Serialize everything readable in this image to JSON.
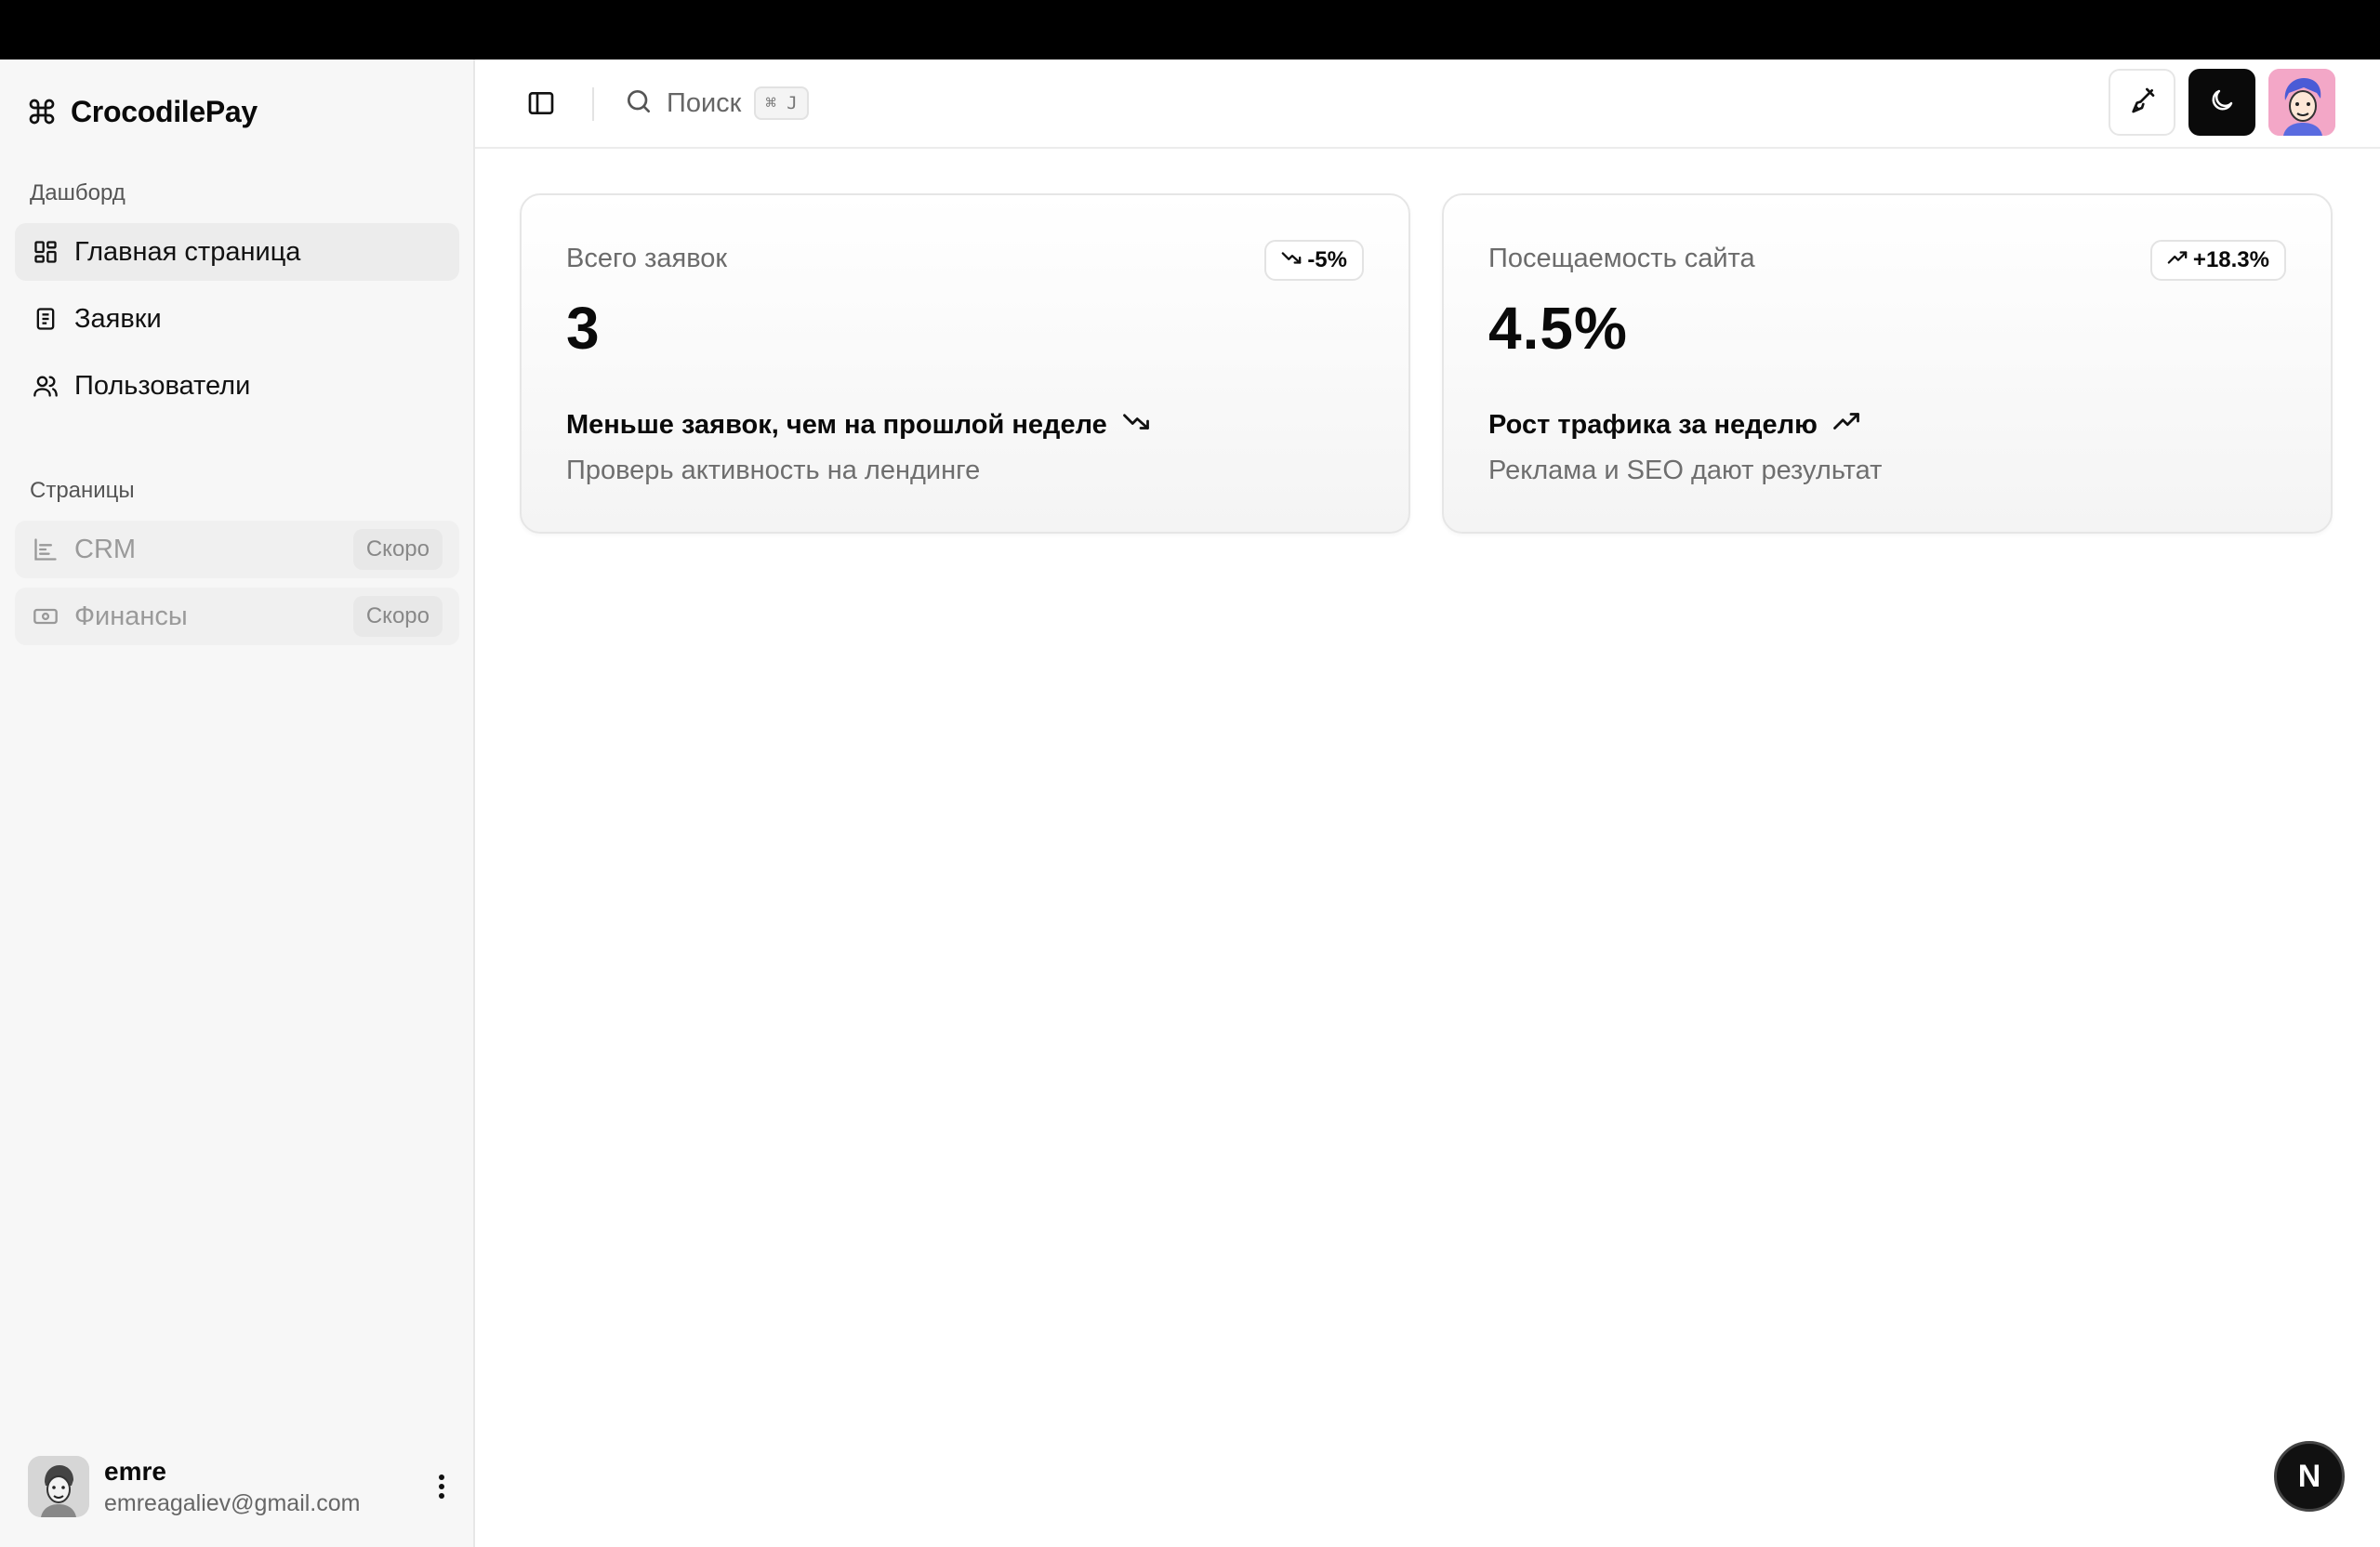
{
  "brand": {
    "name": "CrocodilePay"
  },
  "sidebar": {
    "group1_label": "Дашборд",
    "items": [
      {
        "label": "Главная страница",
        "icon": "dashboard-icon",
        "active": true
      },
      {
        "label": "Заявки",
        "icon": "document-icon"
      },
      {
        "label": "Пользователи",
        "icon": "users-icon"
      }
    ],
    "group2_label": "Страницы",
    "pages": [
      {
        "label": "CRM",
        "icon": "chart-icon",
        "badge": "Скоро"
      },
      {
        "label": "Финансы",
        "icon": "banknote-icon",
        "badge": "Скоро"
      }
    ],
    "user": {
      "name": "emre",
      "email": "emreagaliev@gmail.com"
    }
  },
  "header": {
    "search_label": "Поиск",
    "shortcut": "⌘ J"
  },
  "cards": [
    {
      "label": "Всего заявок",
      "value": "3",
      "badge": "-5%",
      "trend": "down",
      "footer": "Меньше заявок, чем на прошлой неделе",
      "sub": "Проверь активность на лендинге"
    },
    {
      "label": "Посещаемость сайта",
      "value": "4.5%",
      "badge": "+18.3%",
      "trend": "up",
      "footer": "Рост трафика за неделю",
      "sub": "Реклама и SEO дают результат"
    }
  ],
  "fab": {
    "label": "N"
  }
}
